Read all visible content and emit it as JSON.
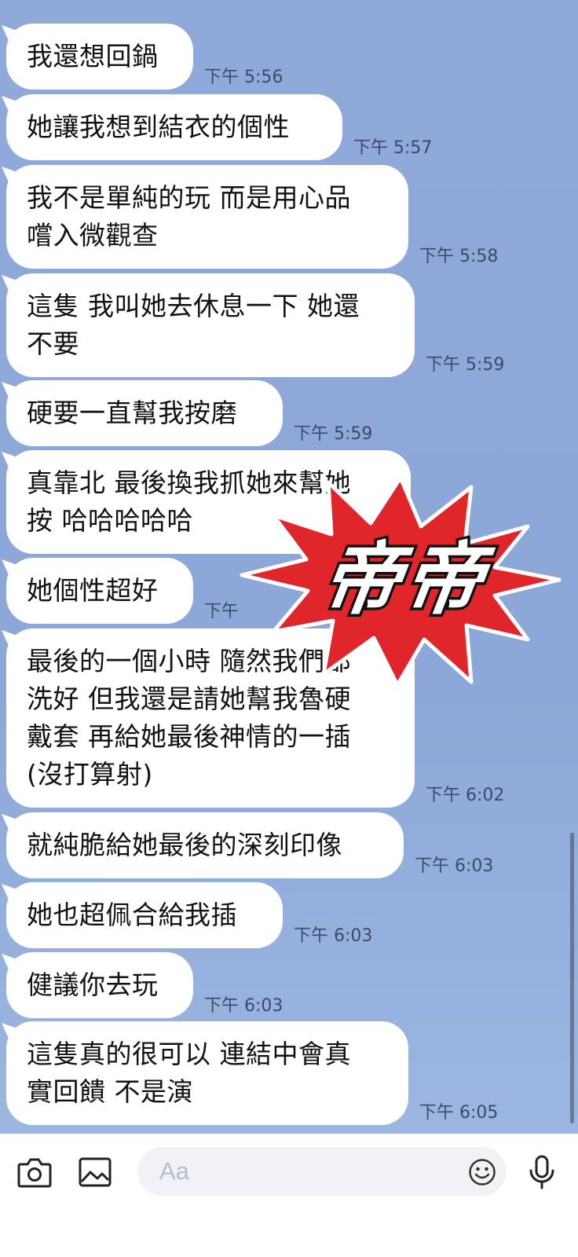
{
  "messages": [
    {
      "text": "我還想回鍋",
      "time": "下午 5:56"
    },
    {
      "text": "她讓我想到結衣的個性",
      "time": "下午 5:57"
    },
    {
      "text": "我不是單純的玩 而是用心品\n嚐入微觀查",
      "time": "下午 5:58"
    },
    {
      "text": "這隻 我叫她去休息一下 她還\n不要",
      "time": "下午 5:59"
    },
    {
      "text": "硬要一直幫我按磨",
      "time": "下午 5:59"
    },
    {
      "text": "真靠北 最後換我抓她來幫她\n按 哈哈哈哈哈",
      "time": ""
    },
    {
      "text": "她個性超好",
      "time": "下午"
    },
    {
      "text": "最後的一個小時 隨然我們都\n洗好 但我還是請她幫我魯硬\n戴套 再給她最後神情的一插\n(沒打算射)",
      "time": "下午 6:02"
    },
    {
      "text": "就純脆給她最後的深刻印像",
      "time": "下午 6:03"
    },
    {
      "text": "她也超佩合給我插",
      "time": "下午 6:03"
    },
    {
      "text": "健議你去玩",
      "time": "下午 6:03"
    },
    {
      "text": "這隻真的很可以 連結中會真\n實回饋 不是演",
      "time": "下午 6:05"
    }
  ],
  "sticker": {
    "text": "帝帝",
    "burst_color": "#e0262a",
    "outline_color": "#111111"
  },
  "input": {
    "placeholder": "Aa"
  },
  "icons": {
    "camera": "camera-icon",
    "gallery": "image-icon",
    "emoji": "smiley-icon",
    "mic": "microphone-icon"
  }
}
